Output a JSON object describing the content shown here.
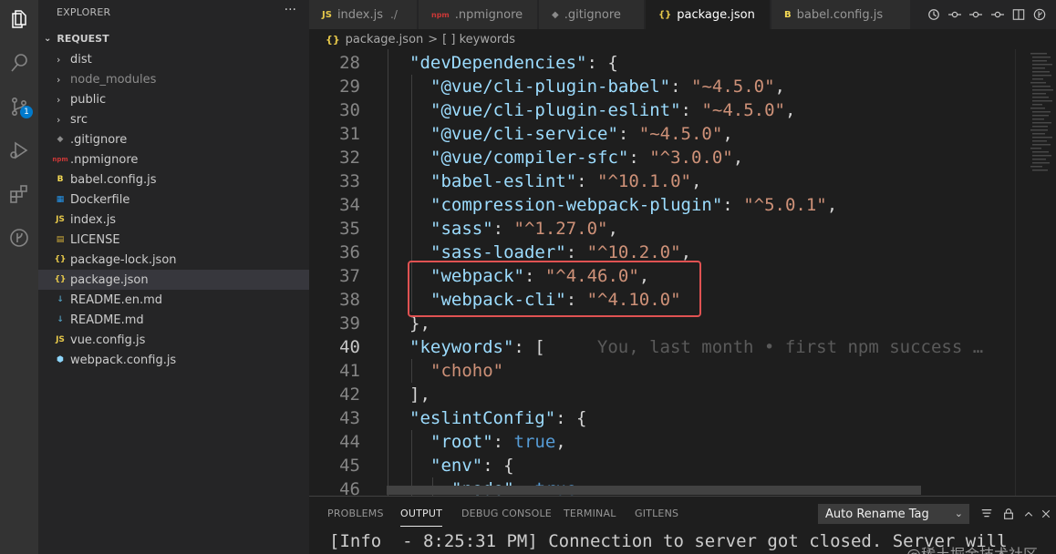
{
  "sidebar": {
    "title": "EXPLORER",
    "more": "···",
    "section": "REQUEST",
    "items": [
      {
        "label": "dist",
        "kind": "folder",
        "dim": false
      },
      {
        "label": "node_modules",
        "kind": "folder",
        "dim": true
      },
      {
        "label": "public",
        "kind": "folder",
        "dim": false
      },
      {
        "label": "src",
        "kind": "folder",
        "dim": false
      },
      {
        "label": ".gitignore",
        "kind": "git",
        "dim": false
      },
      {
        "label": ".npmignore",
        "kind": "npm",
        "dim": false
      },
      {
        "label": "babel.config.js",
        "kind": "babel",
        "dim": false
      },
      {
        "label": "Dockerfile",
        "kind": "docker",
        "dim": false
      },
      {
        "label": "index.js",
        "kind": "js",
        "dim": false
      },
      {
        "label": "LICENSE",
        "kind": "license",
        "dim": false
      },
      {
        "label": "package-lock.json",
        "kind": "json",
        "dim": false
      },
      {
        "label": "package.json",
        "kind": "json",
        "dim": false,
        "selected": true
      },
      {
        "label": "README.en.md",
        "kind": "md",
        "dim": false
      },
      {
        "label": "README.md",
        "kind": "md",
        "dim": false
      },
      {
        "label": "vue.config.js",
        "kind": "js",
        "dim": false
      },
      {
        "label": "webpack.config.js",
        "kind": "webpack",
        "dim": false
      }
    ]
  },
  "activity": {
    "scm_badge": "1"
  },
  "tabs": [
    {
      "label": "index.js",
      "suffix": "./",
      "icon": "JS",
      "active": false
    },
    {
      "label": ".npmignore",
      "icon": "npm",
      "active": false
    },
    {
      "label": ".gitignore",
      "icon": "git",
      "active": false
    },
    {
      "label": "package.json",
      "icon": "{}",
      "active": true
    },
    {
      "label": "babel.config.js",
      "icon": "babel",
      "active": false
    }
  ],
  "breadcrumb": {
    "file": "package.json",
    "sep": ">",
    "symbol": "[ ] keywords",
    "icon": "{}"
  },
  "editor": {
    "lines": [
      {
        "n": "28",
        "indent": 1,
        "parts": [
          [
            "k",
            "\"devDependencies\""
          ],
          [
            "p",
            ": {"
          ]
        ]
      },
      {
        "n": "29",
        "indent": 2,
        "parts": [
          [
            "k",
            "\"@vue/cli-plugin-babel\""
          ],
          [
            "p",
            ": "
          ],
          [
            "s",
            "\"~4.5.0\""
          ],
          [
            "p",
            ","
          ]
        ]
      },
      {
        "n": "30",
        "indent": 2,
        "parts": [
          [
            "k",
            "\"@vue/cli-plugin-eslint\""
          ],
          [
            "p",
            ": "
          ],
          [
            "s",
            "\"~4.5.0\""
          ],
          [
            "p",
            ","
          ]
        ]
      },
      {
        "n": "31",
        "indent": 2,
        "parts": [
          [
            "k",
            "\"@vue/cli-service\""
          ],
          [
            "p",
            ": "
          ],
          [
            "s",
            "\"~4.5.0\""
          ],
          [
            "p",
            ","
          ]
        ]
      },
      {
        "n": "32",
        "indent": 2,
        "parts": [
          [
            "k",
            "\"@vue/compiler-sfc\""
          ],
          [
            "p",
            ": "
          ],
          [
            "s",
            "\"^3.0.0\""
          ],
          [
            "p",
            ","
          ]
        ]
      },
      {
        "n": "33",
        "indent": 2,
        "parts": [
          [
            "k",
            "\"babel-eslint\""
          ],
          [
            "p",
            ": "
          ],
          [
            "s",
            "\"^10.1.0\""
          ],
          [
            "p",
            ","
          ]
        ]
      },
      {
        "n": "34",
        "indent": 2,
        "parts": [
          [
            "k",
            "\"compression-webpack-plugin\""
          ],
          [
            "p",
            ": "
          ],
          [
            "s",
            "\"^5.0.1\""
          ],
          [
            "p",
            ","
          ]
        ]
      },
      {
        "n": "35",
        "indent": 2,
        "parts": [
          [
            "k",
            "\"sass\""
          ],
          [
            "p",
            ": "
          ],
          [
            "s",
            "\"^1.27.0\""
          ],
          [
            "p",
            ","
          ]
        ]
      },
      {
        "n": "36",
        "indent": 2,
        "parts": [
          [
            "k",
            "\"sass-loader\""
          ],
          [
            "p",
            ": "
          ],
          [
            "s",
            "\"^10.2.0\""
          ],
          [
            "p",
            ","
          ]
        ]
      },
      {
        "n": "37",
        "indent": 2,
        "parts": [
          [
            "k",
            "\"webpack\""
          ],
          [
            "p",
            ": "
          ],
          [
            "s",
            "\"^4.46.0\""
          ],
          [
            "p",
            ","
          ]
        ]
      },
      {
        "n": "38",
        "indent": 2,
        "parts": [
          [
            "k",
            "\"webpack-cli\""
          ],
          [
            "p",
            ": "
          ],
          [
            "s",
            "\"^4.10.0\""
          ]
        ]
      },
      {
        "n": "39",
        "indent": 1,
        "parts": [
          [
            "p",
            "},"
          ]
        ]
      },
      {
        "n": "40",
        "indent": 1,
        "current": true,
        "parts": [
          [
            "k",
            "\"keywords\""
          ],
          [
            "p",
            ": ["
          ],
          [
            "blame",
            "     You, last month • first npm success …"
          ]
        ]
      },
      {
        "n": "41",
        "indent": 2,
        "parts": [
          [
            "s",
            "\"choho\""
          ]
        ]
      },
      {
        "n": "42",
        "indent": 1,
        "parts": [
          [
            "p",
            "],"
          ]
        ]
      },
      {
        "n": "43",
        "indent": 1,
        "parts": [
          [
            "k",
            "\"eslintConfig\""
          ],
          [
            "p",
            ": {"
          ]
        ]
      },
      {
        "n": "44",
        "indent": 2,
        "parts": [
          [
            "k",
            "\"root\""
          ],
          [
            "p",
            ": "
          ],
          [
            "b",
            "true"
          ],
          [
            "p",
            ","
          ]
        ]
      },
      {
        "n": "45",
        "indent": 2,
        "parts": [
          [
            "k",
            "\"env\""
          ],
          [
            "p",
            ": {"
          ]
        ]
      },
      {
        "n": "46",
        "indent": 3,
        "parts": [
          [
            "k",
            "\"node\""
          ],
          [
            "p",
            ": "
          ],
          [
            "b",
            "true"
          ]
        ]
      }
    ]
  },
  "panel": {
    "tabs": [
      {
        "label": "PROBLEMS",
        "active": false
      },
      {
        "label": "OUTPUT",
        "active": true
      },
      {
        "label": "DEBUG CONSOLE",
        "active": false
      },
      {
        "label": "TERMINAL",
        "active": false
      },
      {
        "label": "GITLENS",
        "active": false
      }
    ],
    "select_value": "Auto Rename Tag",
    "output_line": "[Info  - 8:25:31 PM] Connection to server got closed. Server will",
    "watermark": "@稀土掘金技术社区"
  },
  "colors": {
    "accent": "#007acc",
    "highlight_box": "#e05252",
    "json_key": "#9cdcfe",
    "json_string": "#ce9178",
    "json_bool": "#569cd6"
  }
}
